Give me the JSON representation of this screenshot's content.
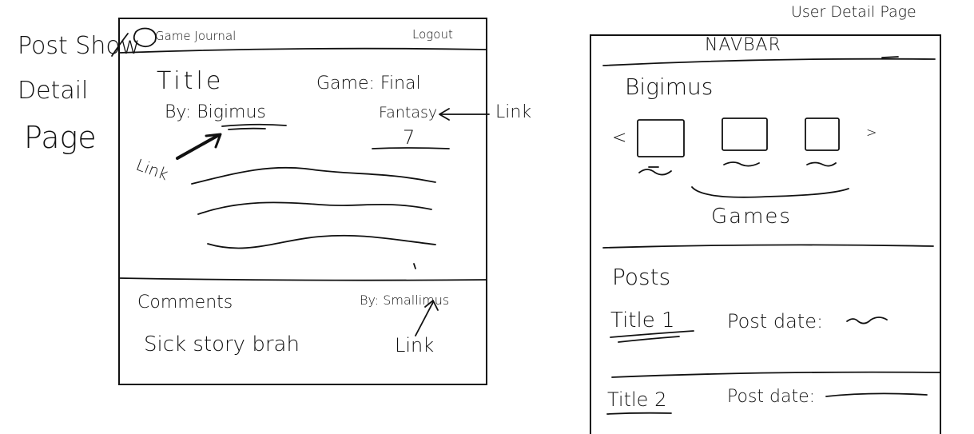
{
  "left_page": {
    "caption": [
      "Post Show",
      "Detail",
      "Page"
    ],
    "navbar": {
      "brand": "Game Journal",
      "logout": "Logout"
    },
    "post": {
      "title": "Title",
      "by": "By: Bigimus",
      "game_line1": "Game: Final",
      "game_line2": "Fantasy",
      "rating": "7"
    },
    "link_labels": {
      "game": "Link",
      "author": "Link",
      "commenter": "Link"
    },
    "comments": {
      "heading": "Comments",
      "by": "By: Smallimus",
      "text": "Sick story brah"
    }
  },
  "right_page": {
    "caption": "User Detail Page",
    "navbar": "NAVBAR",
    "username": "Bigimus",
    "carousel": {
      "prev": "<",
      "next": ">",
      "label": "Games"
    },
    "posts": {
      "heading": "Posts",
      "items": [
        {
          "title": "Title 1",
          "date_label": "Post date:"
        },
        {
          "title": "Title 2",
          "date_label": "Post date:"
        }
      ]
    }
  }
}
